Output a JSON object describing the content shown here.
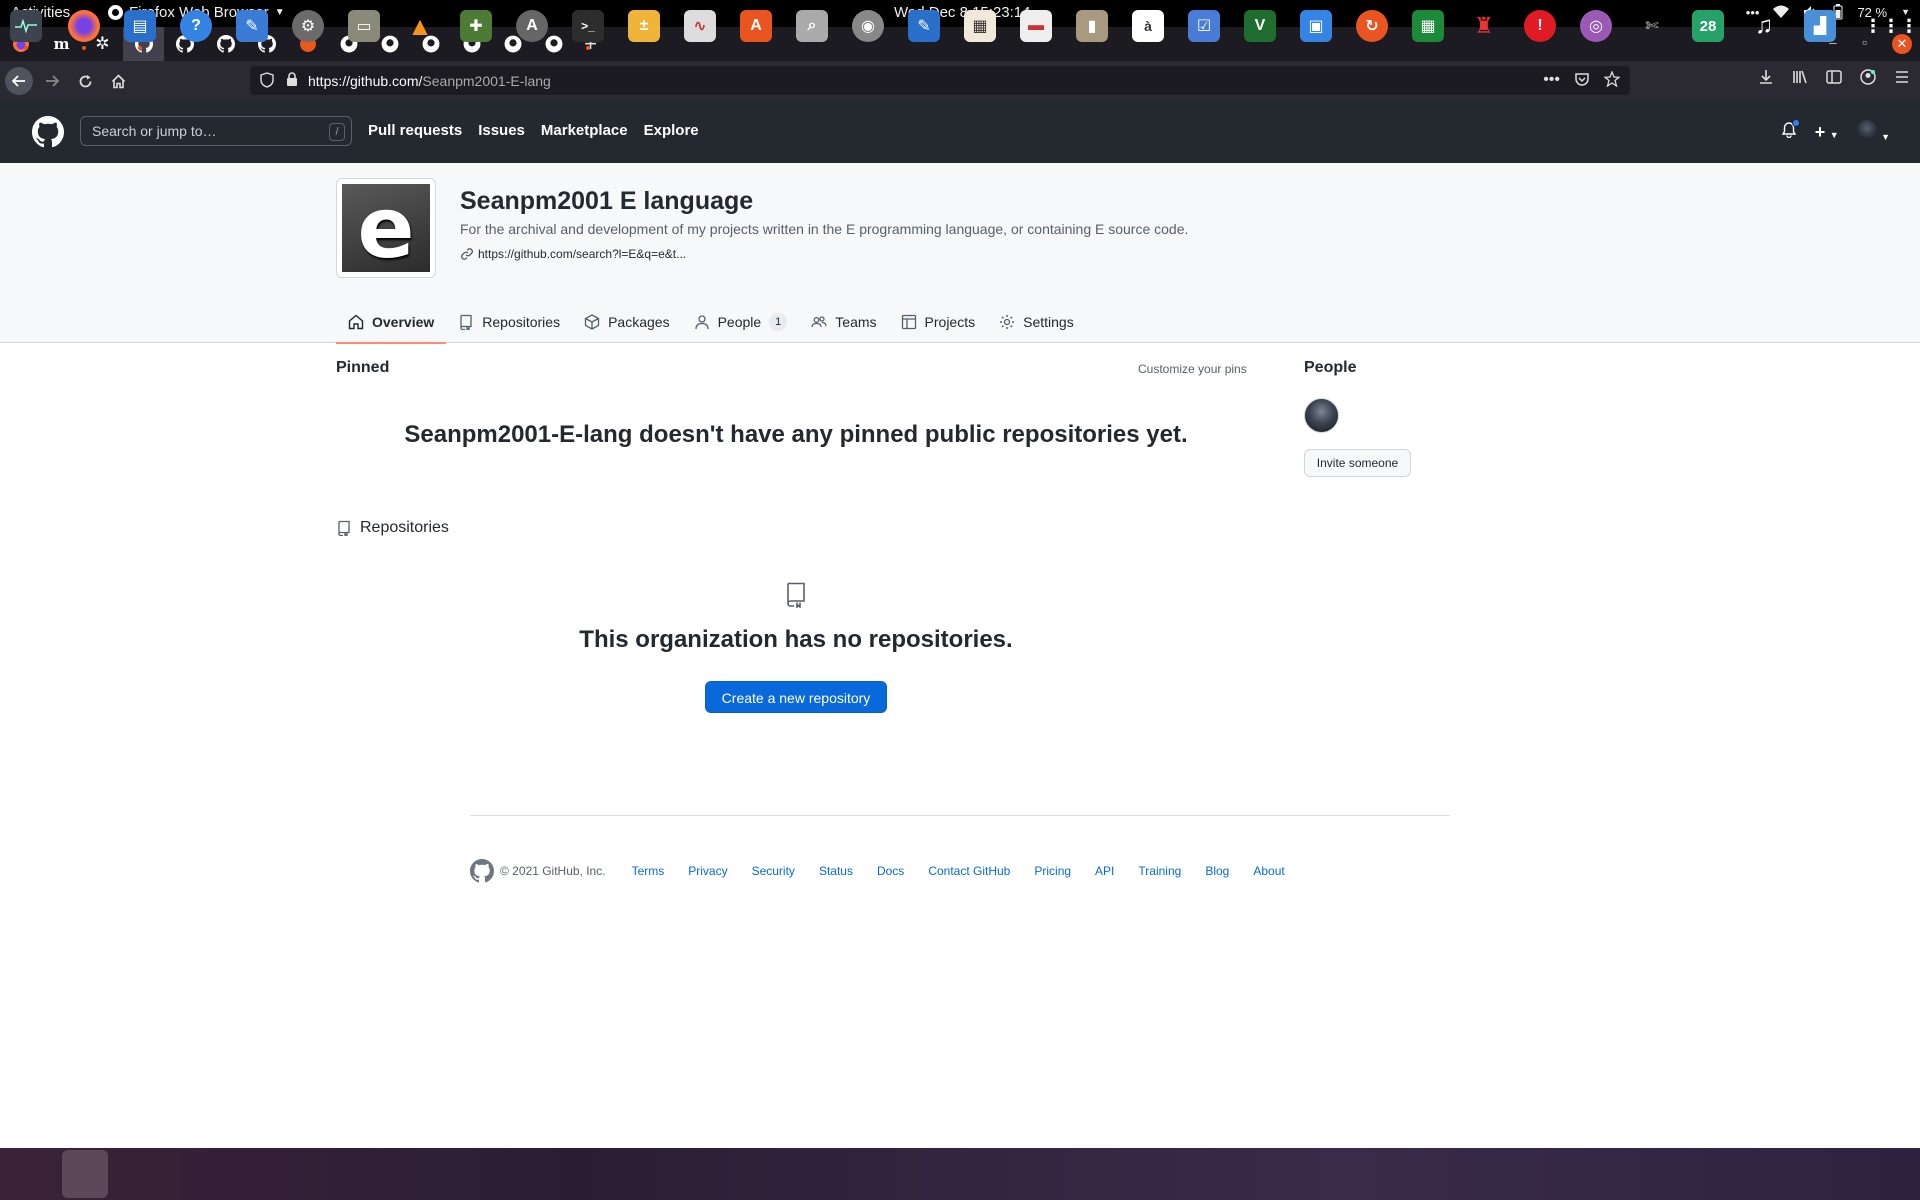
{
  "system": {
    "activities": "Activities",
    "app_menu": "Firefox Web Browser",
    "clock": "Wed Dec 8  15:23:14",
    "battery": "72 %"
  },
  "browser": {
    "url_host": "https://github.com/",
    "url_path": "Seanpm2001-E-lang",
    "tabs": [
      {
        "icon": "firefox-icon"
      },
      {
        "icon": "m-icon",
        "label": "m"
      },
      {
        "icon": "gear-icon"
      },
      {
        "icon": "github-icon",
        "active": true
      },
      {
        "icon": "github-icon"
      },
      {
        "icon": "github-icon"
      },
      {
        "icon": "github-icon"
      },
      {
        "icon": "orange-circle-icon"
      },
      {
        "icon": "github-icon"
      },
      {
        "icon": "github-icon"
      },
      {
        "icon": "github-icon"
      },
      {
        "icon": "github-icon"
      },
      {
        "icon": "github-icon"
      },
      {
        "icon": "github-icon"
      }
    ],
    "new_tab": "+"
  },
  "github": {
    "search_placeholder": "Search or jump to…",
    "search_shortcut": "/",
    "nav": {
      "pull_requests": "Pull requests",
      "issues": "Issues",
      "marketplace": "Marketplace",
      "explore": "Explore"
    }
  },
  "org": {
    "avatar_letter": "e",
    "name": "Seanpm2001 E language",
    "description": "For the archival and development of my projects written in the E programming language, or containing E source code.",
    "link": "https://github.com/search?l=E&q=e&t...",
    "tabs": {
      "overview": "Overview",
      "repositories": "Repositories",
      "packages": "Packages",
      "people": "People",
      "people_count": "1",
      "teams": "Teams",
      "projects": "Projects",
      "settings": "Settings"
    }
  },
  "main": {
    "pinned_title": "Pinned",
    "customize_pins": "Customize your pins",
    "pinned_empty": "Seanpm2001-E-lang doesn't have any pinned public repositories yet.",
    "repositories_title": "Repositories",
    "no_repos": "This organization has no repositories.",
    "create_repo": "Create a new repository"
  },
  "sidebar": {
    "people_title": "People",
    "invite": "Invite someone"
  },
  "footer": {
    "copyright": "© 2021 GitHub, Inc.",
    "links": [
      "Terms",
      "Privacy",
      "Security",
      "Status",
      "Docs",
      "Contact GitHub",
      "Pricing",
      "API",
      "Training",
      "Blog",
      "About"
    ]
  },
  "dock": {
    "calendar_day": "28"
  },
  "colors": {
    "accent_blue": "#0969da",
    "tab_underline": "#fd8c73",
    "header_bg": "#24292f"
  }
}
